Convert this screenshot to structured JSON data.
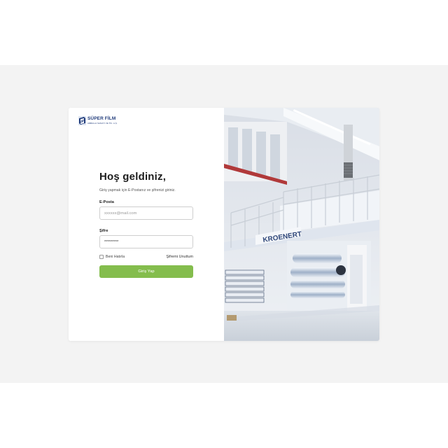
{
  "brand": {
    "name": "SÜPER FİLM",
    "subtitle": "AMBALAJ SANAYİ VE TİC. A.Ş."
  },
  "login": {
    "title": "Hoş geldiniz,",
    "subtitle": "Giriş yapmak için E-Postanız ve şifrenizi giriniz.",
    "email_label": "E-Posta",
    "email_placeholder": "xxxxxx@mail.com",
    "password_label": "Şifre",
    "password_value": "*********",
    "remember_label": "Beni Hatırla",
    "forgot_label": "Şifremi Unuttum",
    "submit_label": "Giriş Yap"
  },
  "hero": {
    "machine_brand": "KROENERT"
  },
  "colors": {
    "accent_green": "#84bd4d",
    "brand_navy": "#1f3a7a",
    "backdrop": "#f3f3f3"
  }
}
